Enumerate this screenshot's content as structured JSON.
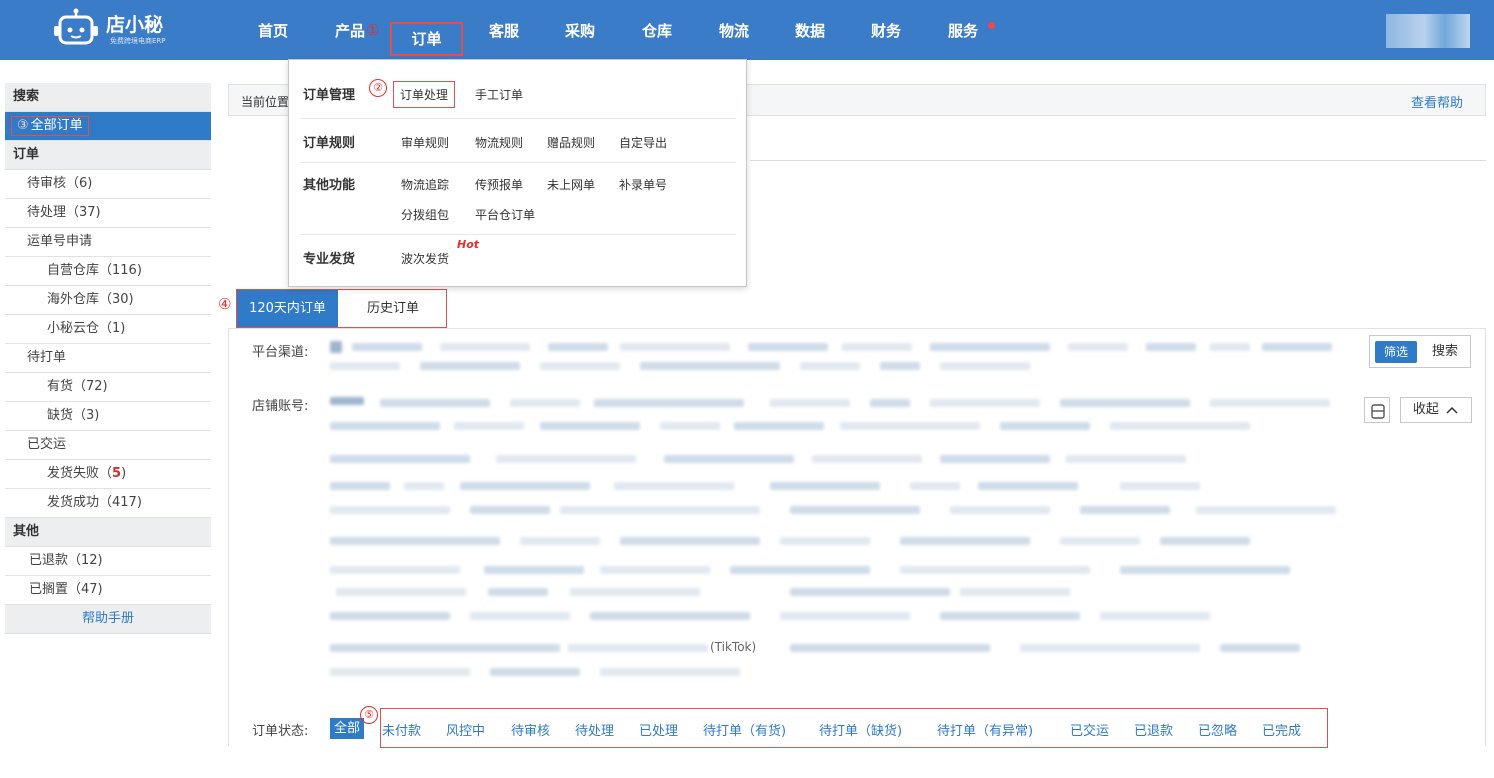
{
  "logo": {
    "name": "店小秘",
    "sub": "免费跨境电商ERP"
  },
  "nav": {
    "items": [
      "首页",
      "产品",
      "订单",
      "客服",
      "采购",
      "仓库",
      "物流",
      "数据",
      "财务",
      "服务"
    ],
    "marker1": "①"
  },
  "sidebar": {
    "search": "搜索",
    "all_orders": "全部订单",
    "marker3": "③",
    "order_head": "订单",
    "pending_review": "待审核（6)",
    "pending_process": "待处理（37)",
    "waybill_apply": "运单号申请",
    "self_wh": "自营仓库（116)",
    "overseas_wh": "海外仓库（30)",
    "cloud_wh": "小秘云仓（1)",
    "to_print": "待打单",
    "in_stock": "有货（72)",
    "out_stock": "缺货（3)",
    "shipped": "已交运",
    "ship_fail_label": "发货失败（",
    "ship_fail_num": "5",
    "ship_fail_close": ")",
    "ship_success": "发货成功（417)",
    "other_head": "其他",
    "refunded": "已退款（12)",
    "shelved": "已搁置（47)",
    "help_manual": "帮助手册"
  },
  "breadcrumb": {
    "label": "当前位置",
    "help": "查看帮助"
  },
  "dropdown": {
    "order_mgmt": "订单管理",
    "marker2": "②",
    "order_process": "订单处理",
    "manual_order": "手工订单",
    "order_rules": "订单规则",
    "review_rules": "审单规则",
    "logistics_rules": "物流规则",
    "gift_rules": "赠品规则",
    "custom_export": "自定导出",
    "other_func": "其他功能",
    "logistics_track": "物流追踪",
    "pre_report": "传预报单",
    "not_online": "未上网单",
    "supplement_no": "补录单号",
    "split_pack": "分拨组包",
    "platform_wh": "平台仓订单",
    "pro_ship": "专业发货",
    "wave_ship": "波次发货",
    "hot": "Hot"
  },
  "tabs": {
    "marker4": "④",
    "recent": "120天内订单",
    "history": "历史订单"
  },
  "filters": {
    "platform": "平台渠道:",
    "shop": "店铺账号:",
    "filter_btn": "筛选",
    "search_btn": "搜索",
    "collapse": "收起",
    "collapse_icon": "chevron-up-icon",
    "tiktok_fragment": "(TikTok)"
  },
  "status": {
    "label": "订单状态:",
    "all": "全部",
    "marker5": "⑤",
    "items": [
      "未付款",
      "风控中",
      "待审核",
      "待处理",
      "已处理",
      "待打单（有货)",
      "待打单（缺货)",
      "待打单（有异常)",
      "已交运",
      "已退款",
      "已忽略",
      "已完成"
    ]
  },
  "colors": {
    "primary": "#3a7cc8",
    "highlight": "#e05050",
    "link": "#2f7bc7"
  }
}
